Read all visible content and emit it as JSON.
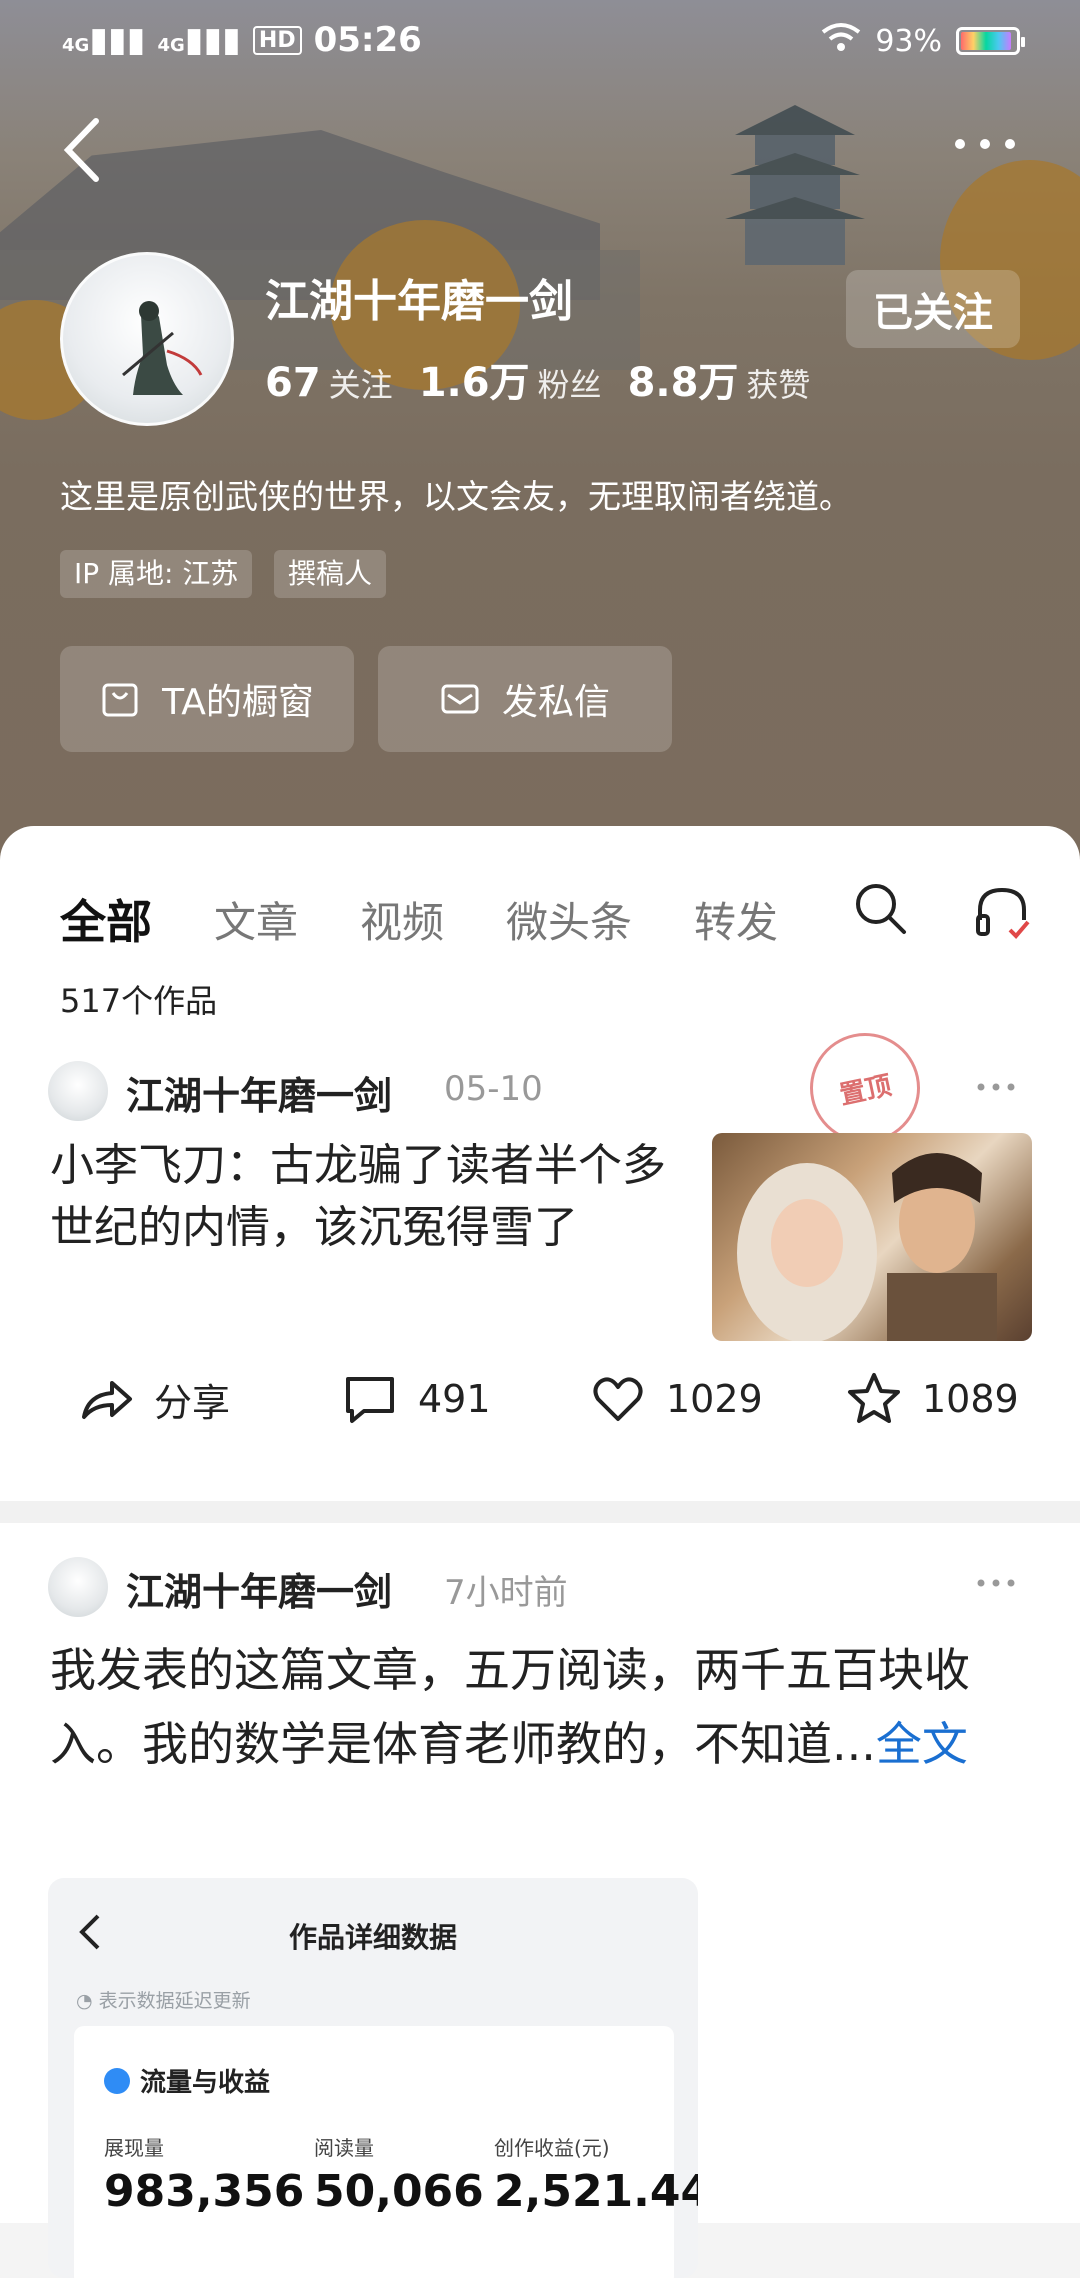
{
  "status_bar": {
    "signal1": "4G",
    "signal2": "4G",
    "hd": "HD",
    "time": "05:26",
    "battery": "93%",
    "battery_level": 0.93
  },
  "profile": {
    "name": "江湖十年磨一剑",
    "follow_label": "已关注",
    "stats": [
      {
        "num": "67",
        "label": "关注"
      },
      {
        "num": "1.6万",
        "label": "粉丝"
      },
      {
        "num": "8.8万",
        "label": "获赞"
      }
    ],
    "bio": "这里是原创武侠的世界，以文会友，无理取闹者绕道。",
    "tags": [
      "IP 属地: 江苏",
      "撰稿人"
    ],
    "actions": [
      "TA的橱窗",
      "发私信"
    ]
  },
  "tabs": [
    "全部",
    "文章",
    "视频",
    "微头条",
    "转发"
  ],
  "works_count": "517个作品",
  "post1": {
    "author": "江湖十年磨一剑",
    "time": "05-10",
    "pinned_label": "置顶",
    "title": "小李飞刀：古龙骗了读者半个多世纪的内情，该沉冤得雪了",
    "share_label": "分享",
    "comments": "491",
    "likes": "1029",
    "favorites": "1089"
  },
  "post2": {
    "author": "江湖十年磨一剑",
    "time": "7小时前",
    "text": "我发表的这篇文章，五万阅读，两千五百块收入。我的数学是体育老师教的，不知道...",
    "full_label": "全文",
    "card": {
      "title": "作品详细数据",
      "note": "表示数据延迟更新",
      "section": "流量与收益",
      "col1_label": "展现量",
      "col2_label": "阅读量",
      "col3_label": "创作收益(元)",
      "col1_value": "983,356",
      "col2_value": "50,066",
      "col3_value": "2,521.44"
    }
  },
  "colors": {
    "accent": "#1a6fd1",
    "header": "#7b6c5d"
  }
}
